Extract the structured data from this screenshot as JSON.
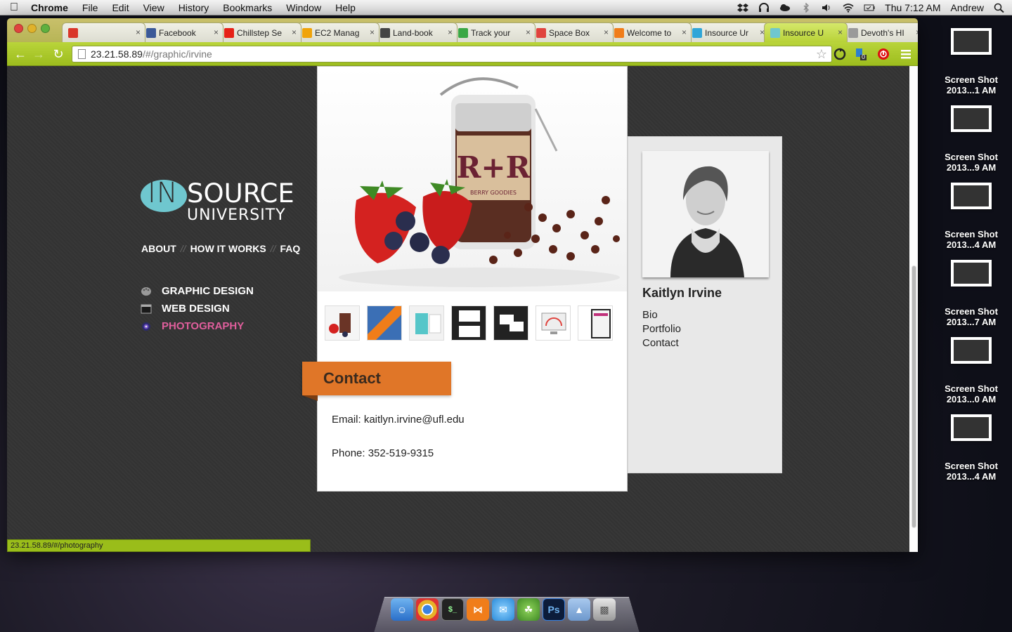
{
  "menubar": {
    "app_name": "Chrome",
    "menus": [
      "File",
      "Edit",
      "View",
      "History",
      "Bookmarks",
      "Window",
      "Help"
    ],
    "clock": "Thu 7:12 AM",
    "user": "Andrew"
  },
  "browser": {
    "tabs": [
      {
        "icon": "gmail-icon",
        "title": "",
        "color": "#d9362a"
      },
      {
        "icon": "facebook-icon",
        "title": "Facebook",
        "color": "#3b5998"
      },
      {
        "icon": "youtube-icon",
        "title": "Chillstep Se",
        "color": "#e62117"
      },
      {
        "icon": "aws-icon",
        "title": "EC2 Manag",
        "color": "#f0a30a"
      },
      {
        "icon": "landbook-icon",
        "title": "Land-book",
        "color": "#444444"
      },
      {
        "icon": "track-icon",
        "title": "Track your",
        "color": "#3aa845"
      },
      {
        "icon": "spacebox-icon",
        "title": "Space Box",
        "color": "#e0443e"
      },
      {
        "icon": "welcome-icon",
        "title": "Welcome to",
        "color": "#f07d1a"
      },
      {
        "icon": "insource-icon",
        "title": "Insource Ur",
        "color": "#30a6d8"
      },
      {
        "icon": "insource-icon",
        "title": "Insource U",
        "color": "#6fc7cf"
      },
      {
        "icon": "document-icon",
        "title": "Devoth's HI",
        "color": "#9a9a9a"
      }
    ],
    "active_tab_index": 9,
    "url_host": "23.21.58.89",
    "url_path": "/#/graphic/irvine",
    "extension_badge": "0",
    "status_url": "23.21.58.89/#/photography"
  },
  "site": {
    "logo": {
      "in": "IN",
      "source": "SOURCE",
      "university": "UNIVERSITY"
    },
    "topnav": [
      "ABOUT",
      "HOW IT WORKS",
      "FAQ"
    ],
    "topnav_sep": "//",
    "categories": [
      {
        "label": "GRAPHIC DESIGN",
        "icon": "palette-icon",
        "active": false
      },
      {
        "label": "WEB DESIGN",
        "icon": "browser-window-icon",
        "active": false
      },
      {
        "label": "PHOTOGRAPHY",
        "icon": "camera-icon",
        "active": true
      }
    ],
    "contact_heading": "Contact",
    "email_line": "Email: kaitlyn.irvine@ufl.edu",
    "phone_line": "Phone: 352-519-9315",
    "person": {
      "name": "Kaitlyn Irvine",
      "links": [
        "Bio",
        "Portfolio",
        "Contact"
      ]
    },
    "hero_label": "R+R",
    "hero_sublabel": "BERRY GOODIES",
    "thumbnail_labels": [
      "R+R jar",
      "orange brochure",
      "book spread",
      "K&B card",
      "card set",
      "web mockup",
      "flyer"
    ],
    "accent_color": "#e07628",
    "photography_color": "#e05e9c"
  },
  "desktop": {
    "icons": [
      {
        "line1": "Screen Shot",
        "line2": "2013...1 AM"
      },
      {
        "line1": "Screen Shot",
        "line2": "2013...9 AM"
      },
      {
        "line1": "Screen Shot",
        "line2": "2013...4 AM"
      },
      {
        "line1": "Screen Shot",
        "line2": "2013...7 AM"
      },
      {
        "line1": "Screen Shot",
        "line2": "2013...0 AM"
      },
      {
        "line1": "Screen Shot",
        "line2": "2013...4 AM"
      }
    ]
  },
  "dock": {
    "apps": [
      "finder-icon",
      "chrome-icon",
      "terminal-icon",
      "xampp-icon",
      "messages-icon",
      "adium-icon",
      "photoshop-icon",
      "applications-folder-icon",
      "trash-icon"
    ]
  }
}
